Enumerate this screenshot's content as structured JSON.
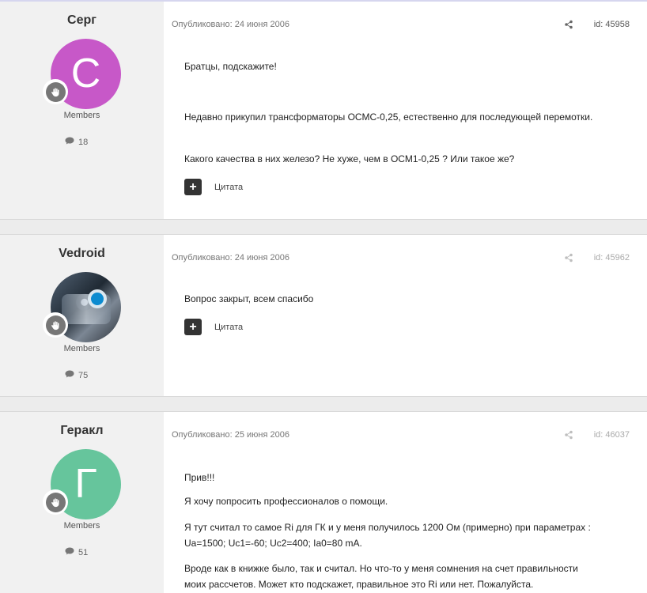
{
  "colors": {
    "page_background": "#ececec",
    "author_panel": "#f1f1f1",
    "post_background": "#ffffff",
    "avatar_serg": "#c758c8",
    "avatar_gerakl": "#66c59c",
    "dark_button": "#333333"
  },
  "posts": [
    {
      "author": "Серг",
      "avatar_letter": "С",
      "role": "Members",
      "posts_count": "18",
      "published": "Опубликовано: 24 июня 2006",
      "id": "id: 45958",
      "paragraphs": [
        "Братцы, подскажите!",
        "Недавно прикупил трансформаторы ОСМС-0,25, естественно для последующей перемотки.",
        "Какого качества в них железо? Не хуже, чем в ОСМ1-0,25 ? Или такое же?"
      ],
      "quote_label": "Цитата"
    },
    {
      "author": "Vedroid",
      "avatar_letter": "",
      "role": "Members",
      "posts_count": "75",
      "published": "Опубликовано: 24 июня 2006",
      "id": "id: 45962",
      "paragraphs": [
        "Вопрос закрыт, всем спасибо"
      ],
      "quote_label": "Цитата"
    },
    {
      "author": "Геракл",
      "avatar_letter": "Г",
      "role": "Members",
      "posts_count": "51",
      "published": "Опубликовано: 25 июня 2006",
      "id": "id: 46037",
      "paragraphs": [
        "Прив!!!",
        "Я хочу попросить профессионалов о помощи.",
        "Я тут считал то самое Ri для ГК и у меня получилось 1200 Ом (примерно) при параметрах : Ua=1500; Uc1=-60; Uc2=400; Ia0=80 mA.",
        "Вроде как в книжке было, так и считал. Но что-то у меня сомнения на счет правильности моих рассчетов. Может кто подскажет, правильное это Ri или нет. Пожалуйста."
      ]
    }
  ],
  "icons": {
    "rank": "hand-icon",
    "comment": "comment-icon",
    "share": "share-icon",
    "quote": "plus-icon"
  }
}
